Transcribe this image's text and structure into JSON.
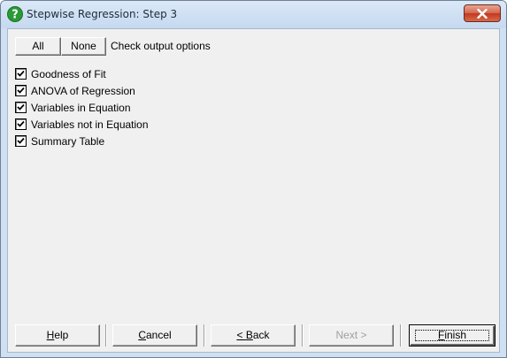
{
  "window": {
    "title": "Stepwise Regression: Step 3",
    "app_icon": "question-icon",
    "close_icon": "close-icon"
  },
  "toolbar": {
    "all_label": "All",
    "none_label": "None",
    "hint": "Check output options"
  },
  "options": [
    {
      "label": "Goodness of Fit",
      "checked": true
    },
    {
      "label": "ANOVA of Regression",
      "checked": true
    },
    {
      "label": "Variables in Equation",
      "checked": true
    },
    {
      "label": "Variables not in Equation",
      "checked": true
    },
    {
      "label": "Summary Table",
      "checked": true
    }
  ],
  "buttons": {
    "help": {
      "mnemonic": "H",
      "rest": "elp"
    },
    "cancel": {
      "mnemonic": "C",
      "rest": "ancel"
    },
    "back": {
      "prefix": "< ",
      "mnemonic": "B",
      "rest": "ack"
    },
    "next": {
      "label": "Next >",
      "enabled": false
    },
    "finish": {
      "mnemonic": "F",
      "rest": "inish",
      "default": true
    }
  },
  "colors": {
    "title_bar": "#c6d9f0",
    "close_button": "#c3381f",
    "dialog_face": "#f0f0f0"
  }
}
